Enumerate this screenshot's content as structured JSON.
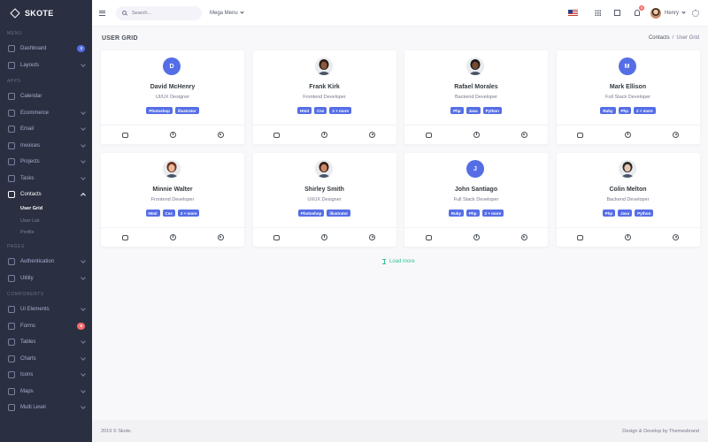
{
  "brand": {
    "name": "SKOTE"
  },
  "sidebar": {
    "sections": [
      {
        "title": "MENU",
        "items": [
          {
            "label": "Dashboard",
            "icon": "home-icon",
            "badge": "3",
            "badge_color": "#556ee6"
          },
          {
            "label": "Layouts",
            "icon": "layout-icon",
            "chevron": true
          }
        ]
      },
      {
        "title": "APPS",
        "items": [
          {
            "label": "Calendar",
            "icon": "calendar-icon"
          },
          {
            "label": "Ecommerce",
            "icon": "store-icon",
            "chevron": true
          },
          {
            "label": "Email",
            "icon": "envelope-icon",
            "chevron": true
          },
          {
            "label": "Invoices",
            "icon": "receipt-icon",
            "chevron": true
          },
          {
            "label": "Projects",
            "icon": "briefcase-icon",
            "chevron": true
          },
          {
            "label": "Tasks",
            "icon": "task-icon",
            "chevron": true
          },
          {
            "label": "Contacts",
            "icon": "contacts-icon",
            "chevron": true,
            "open": true,
            "sub": [
              "User Grid",
              "User List",
              "Profile"
            ]
          }
        ]
      },
      {
        "title": "PAGES",
        "items": [
          {
            "label": "Authentication",
            "icon": "user-circle-icon",
            "chevron": true
          },
          {
            "label": "Utility",
            "icon": "file-icon",
            "chevron": true
          }
        ]
      },
      {
        "title": "COMPONENTS",
        "items": [
          {
            "label": "UI Elements",
            "icon": "tone-icon",
            "chevron": true
          },
          {
            "label": "Forms",
            "icon": "forms-icon",
            "badge": "6",
            "badge_color": "#f46a6a"
          },
          {
            "label": "Tables",
            "icon": "list-icon",
            "chevron": true
          },
          {
            "label": "Charts",
            "icon": "bar-chart-icon",
            "chevron": true
          },
          {
            "label": "Icons",
            "icon": "aperture-icon",
            "chevron": true
          },
          {
            "label": "Maps",
            "icon": "map-icon",
            "chevron": true
          },
          {
            "label": "Multi Level",
            "icon": "share-icon",
            "chevron": true
          }
        ]
      }
    ]
  },
  "topbar": {
    "search_placeholder": "Search...",
    "mega_menu": "Mega Menu",
    "notification_count": "3",
    "user_name": "Henry"
  },
  "page": {
    "title": "USER GRID",
    "breadcrumb": [
      "Contacts",
      "User Grid"
    ]
  },
  "users": [
    {
      "name": "David McHenry",
      "role": "UI/UX Designer",
      "initial": "D",
      "photo": false,
      "tags": [
        "Photoshop",
        "illustrator"
      ]
    },
    {
      "name": "Frank Kirk",
      "role": "Frontend Developer",
      "photo": true,
      "skin": "#8a5a3c",
      "hair": "#2b1d14",
      "tags": [
        "Html",
        "Css",
        "2 + more"
      ]
    },
    {
      "name": "Rafael Morales",
      "role": "Backend Developer",
      "photo": true,
      "skin": "#7a4a30",
      "hair": "#1a1a1a",
      "tags": [
        "Php",
        "Java",
        "Python"
      ]
    },
    {
      "name": "Mark Ellison",
      "role": "Full Stack Developer",
      "initial": "M",
      "photo": false,
      "tags": [
        "Ruby",
        "Php",
        "2 + more"
      ]
    },
    {
      "name": "Minnie Walter",
      "role": "Frontend Developer",
      "photo": true,
      "skin": "#e8b79a",
      "hair": "#6b2f20",
      "tags": [
        "Html",
        "Css",
        "2 + more"
      ]
    },
    {
      "name": "Shirley Smith",
      "role": "UI/UX Designer",
      "photo": true,
      "skin": "#c98a6a",
      "hair": "#3b1a14",
      "tags": [
        "Photoshop",
        "illustrator"
      ]
    },
    {
      "name": "John Santiago",
      "role": "Full Stack Developer",
      "initial": "J",
      "photo": false,
      "tags": [
        "Ruby",
        "Php",
        "2 + more"
      ]
    },
    {
      "name": "Colin Melton",
      "role": "Backend Developer",
      "photo": true,
      "skin": "#e6c6ae",
      "hair": "#2a2a2a",
      "tags": [
        "Php",
        "Java",
        "Python"
      ]
    }
  ],
  "load_more": "Load more",
  "footer": {
    "left": "2019 © Skote.",
    "right": "Design & Develop by Themesbrand"
  },
  "colors": {
    "primary": "#556ee6",
    "success": "#34c38f",
    "danger": "#f46a6a",
    "sidebar_bg": "#2a3042"
  }
}
